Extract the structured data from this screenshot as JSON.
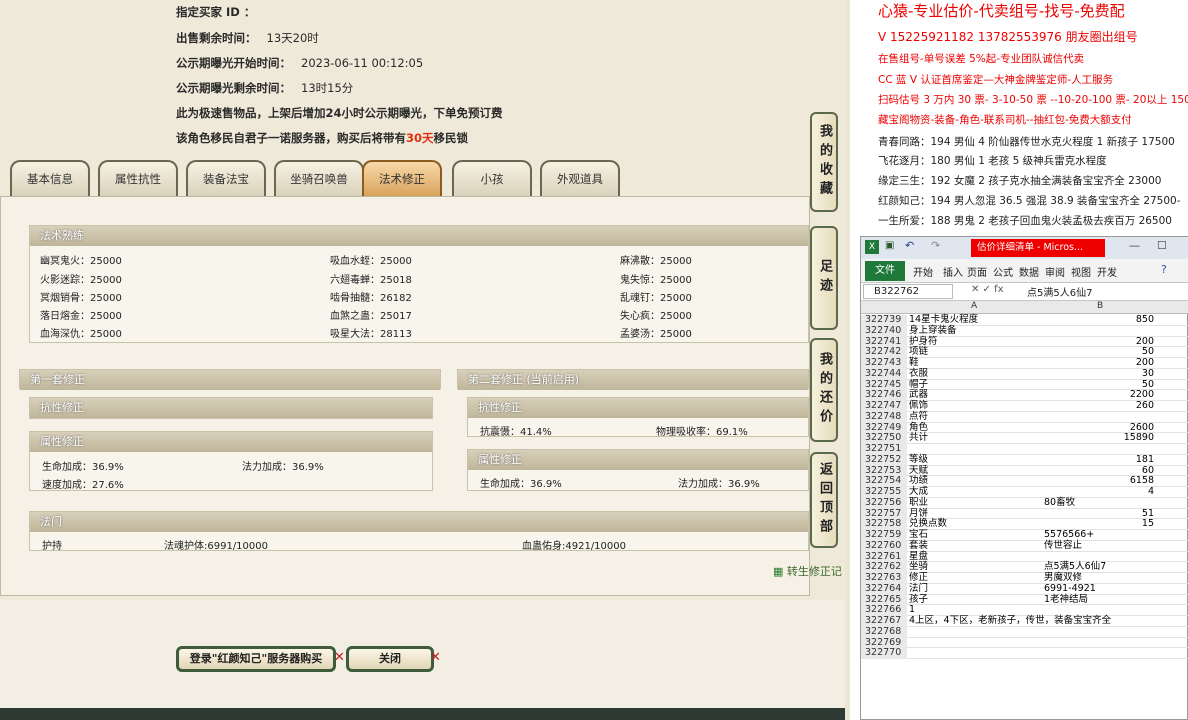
{
  "info": {
    "buyer_label": "指定买家 ID ：",
    "remain_label": "出售剩余时间：",
    "remain_value": "13天20时",
    "expose_start_label": "公示期曝光开始时间：",
    "expose_start_value": "2023-06-11 00:12:05",
    "expose_remain_label": "公示期曝光剩余时间：",
    "expose_remain_value": "13时15分",
    "notice1": "此为极速售物品，上架后增加24小时公示期曝光，下单免预订费",
    "notice2_a": "该角色移民自君子一诺服务器，购买后将带有",
    "notice2_b": "30天",
    "notice2_c": "移民锁"
  },
  "tabs": [
    "基本信息",
    "属性抗性",
    "装备法宝",
    "坐骑召唤兽",
    "法术修正",
    "小孩",
    "外观道具"
  ],
  "spells": {
    "title": "法术熟练",
    "items": [
      [
        "幽冥鬼火：25000",
        "吸血水蛭：25000",
        "麻沸散：25000"
      ],
      [
        "火影迷踪：25000",
        "六翅毒蝉：25018",
        "鬼失惊：25000"
      ],
      [
        "冥烟销骨：25000",
        "啮骨抽髓：26182",
        "乱魂钉：25000"
      ],
      [
        "落日熔金：25000",
        "血煞之蛊：25017",
        "失心疯：25000"
      ],
      [
        "血海深仇：25000",
        "吸星大法：28113",
        "孟婆汤：25000"
      ]
    ]
  },
  "set1": {
    "title": "第一套修正",
    "resist_title": "抗性修正",
    "attr_title": "属性修正",
    "attr": [
      "生命加成：36.9%",
      "法力加成：36.9%",
      "速度加成：27.6%"
    ]
  },
  "set2": {
    "title": "第二套修正 (当前启用)",
    "resist_title": "抗性修正",
    "resist": [
      "抗震慑：41.4%",
      "物理吸收率：69.1%"
    ],
    "attr_title": "属性修正",
    "attr": [
      "生命加成：36.9%",
      "法力加成：36.9%"
    ]
  },
  "fa": {
    "title": "法门",
    "items": [
      "护持",
      "法魂护体:6991/10000",
      "血蛊佑身:4921/10000"
    ]
  },
  "convert_link": "转生修正记",
  "buttons": {
    "login": "登录\"红颜知己\"服务器购买",
    "close": "关闭"
  },
  "side": [
    "我的收藏",
    "足迹",
    "我的还价",
    "返回顶部"
  ],
  "right_lines": [
    "心猿-专业估价-代卖组号-找号-免费配",
    "V 15225921182   13782553976 朋友圈出组号",
    "在售组号-单号误差 5%起-专业团队诚信代卖",
    "CC 蓝 V 认证首席鉴定—大神金牌鉴定师-人工服务",
    "扫码估号 3 万内 30 票- 3-10-50 票  --10-20-100 票- 20以上 150",
    "藏宝阁物资-装备-角色-联系司机--抽红包-免费大额支付",
    "青春同路：194 男仙 4 阶仙器传世水克火程度 1 新孩子 17500",
    "飞花逐月：180 男仙 1 老孩 5 级神兵雷克水程度",
    "缘定三生：192 女魔 2 孩子克水抽全满装备宝宝齐全 23000",
    "红颜知己：194 男人忽混 36.5 强混 38.9 装备宝宝齐全 27500-",
    "一生所爱：188 男鬼 2 老孩子回血鬼火装孟极去疾百万 26500"
  ],
  "excel": {
    "title": "估价详细清单 - Micros...",
    "ribbon": [
      "文件",
      "开始",
      "插入",
      "页面",
      "公式",
      "数据",
      "审阅",
      "视图",
      "开发"
    ],
    "name_box": "B322762",
    "formula": "点5满5人6仙7",
    "col_a": "A",
    "col_b": "B",
    "rows": [
      [
        "322739",
        "14星卡鬼火程度",
        "850"
      ],
      [
        "322740",
        "身上穿装备",
        ""
      ],
      [
        "322741",
        "护身符",
        "200"
      ],
      [
        "322742",
        "项链",
        "50"
      ],
      [
        "322743",
        "鞋",
        "200"
      ],
      [
        "322744",
        "衣服",
        "30"
      ],
      [
        "322745",
        "帽子",
        "50"
      ],
      [
        "322746",
        "武器",
        "2200"
      ],
      [
        "322747",
        "佩饰",
        "260"
      ],
      [
        "322748",
        "点符",
        ""
      ],
      [
        "322749",
        "角色",
        "2600"
      ],
      [
        "322750",
        "共计",
        "15890"
      ],
      [
        "322751",
        "",
        ""
      ],
      [
        "322752",
        "等级",
        "181"
      ],
      [
        "322753",
        "天赋",
        "60"
      ],
      [
        "322754",
        "功绩",
        "6158"
      ],
      [
        "322755",
        "大成",
        "4"
      ],
      [
        "322756",
        "职业",
        "80畜牧"
      ],
      [
        "322757",
        "月饼",
        "51"
      ],
      [
        "322758",
        "兑换点数",
        "15"
      ],
      [
        "322759",
        "宝石",
        "5576566+"
      ],
      [
        "322760",
        "套装",
        "传世容止"
      ],
      [
        "322761",
        "星盘",
        ""
      ],
      [
        "322762",
        "坐骑",
        "点5满5人6仙7"
      ],
      [
        "322763",
        "修正",
        "男魔双修"
      ],
      [
        "322764",
        "法门",
        "6991-4921"
      ],
      [
        "322765",
        "孩子",
        "1老神结局"
      ],
      [
        "322766",
        "1",
        ""
      ],
      [
        "322767",
        "4上区，4下区，老新孩子，传世，装备宝宝齐全",
        ""
      ],
      [
        "322768",
        "",
        ""
      ],
      [
        "322769",
        "",
        ""
      ],
      [
        "322770",
        "",
        ""
      ]
    ]
  }
}
